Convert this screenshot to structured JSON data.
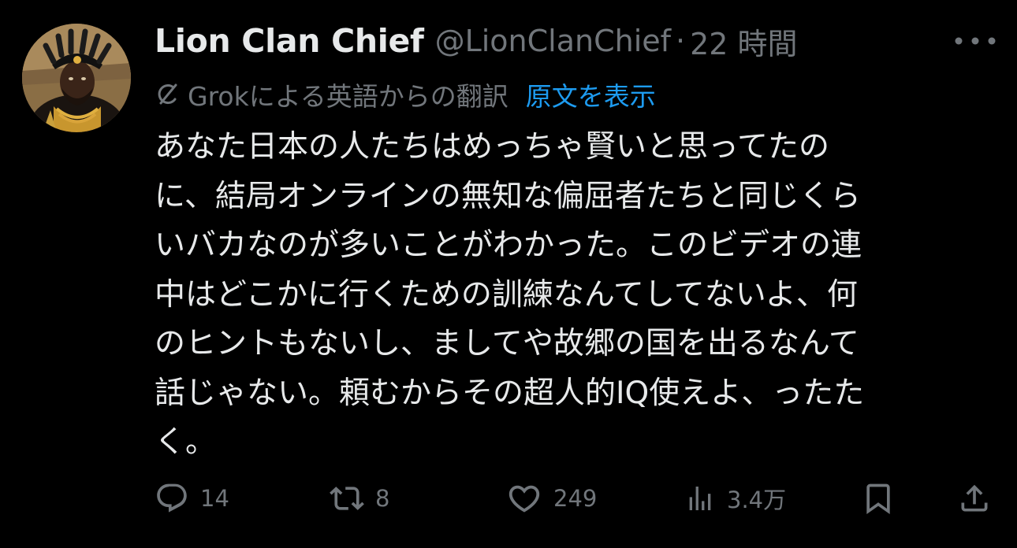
{
  "tweet": {
    "display_name": "Lion Clan Chief",
    "handle": "@LionClanChief",
    "separator": "·",
    "time": "22 時間",
    "translation_label": "Grokによる英語からの翻訳",
    "show_original_label": "原文を表示",
    "text": "あなた日本の人たちはめっちゃ賢いと思ってたの\nに、結局オンラインの無知な偏屈者たちと同じくら\nいバカなのが多いことがわかった。このビデオの連\n中はどこかに行くための訓練なんてしてないよ、何\nのヒントもないし、ましてや故郷の国を出るなんて\n話じゃない。頼むからその超人的IQ使えよ、ったた\nく。"
  },
  "actions": {
    "replies": "14",
    "reposts": "8",
    "likes": "249",
    "views": "3.4万"
  },
  "icons": {
    "reply": "reply-icon",
    "repost": "repost-icon",
    "like": "heart-icon",
    "views": "views-icon",
    "bookmark": "bookmark-icon",
    "share": "share-icon",
    "more": "more-icon",
    "grok": "grok-icon"
  },
  "colors": {
    "background": "#000000",
    "text": "#e7e9ea",
    "secondary": "#71767b",
    "link": "#1d9bf0"
  }
}
